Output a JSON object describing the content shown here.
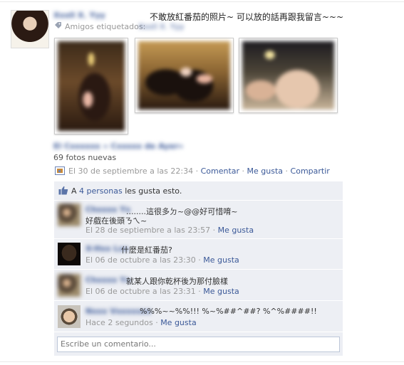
{
  "post": {
    "author": "Xxxll X. Yyy",
    "text": "不敢放紅番茄的照片~ 可以放的話再跟我留言~~~",
    "tagged_label": "Amigos etiquetados:",
    "tagged_names": "Xxxll X. Yyy",
    "album_title": "El Cxxxxxx » Cxxxxx de Ayer»",
    "photo_count": "69 fotos nuevas",
    "timestamp": "El 30 de septiembre a las 22:34",
    "actions": [
      "Comentar",
      "Me gusta",
      "Compartir"
    ],
    "separator": "·"
  },
  "likes": {
    "prefix": "A",
    "count_link": "4 personas",
    "suffix": "les gusta esto."
  },
  "comments": [
    {
      "author": "Chxxxx Yx",
      "line1": "........這很多ㄉ~@@好可惜唷~",
      "line2": "好戲在後頭ㄋㄟ~",
      "time": "El 28 de septiembre a las 23:57",
      "like": "Me gusta"
    },
    {
      "author": "X-Hxx Lxx",
      "line1": "什麼是紅番茄?",
      "time": "El 06 de octubre a las 23:30",
      "like": "Me gusta"
    },
    {
      "author": "Chxxxx Yx",
      "line1": "就某人跟你乾杯後为那付臉樣",
      "time": "El 06 de octubre a las 23:31",
      "like": "Me gusta"
    },
    {
      "author": "Nxxx Vxxxxxxx",
      "line1": "%%%~~%%!!! %~%##^##? %^%####!!",
      "time": "Hace 2 segundos",
      "like": "Me gusta"
    }
  ],
  "comment_box": {
    "placeholder": "Escribe un comentario..."
  },
  "icons": {
    "tag": "tag-icon",
    "photo": "photo-album-icon",
    "like": "thumbs-up-icon"
  },
  "colors": {
    "link": "#3b5998",
    "feedback_bg": "#edeff4",
    "meta_grey": "#999999"
  }
}
